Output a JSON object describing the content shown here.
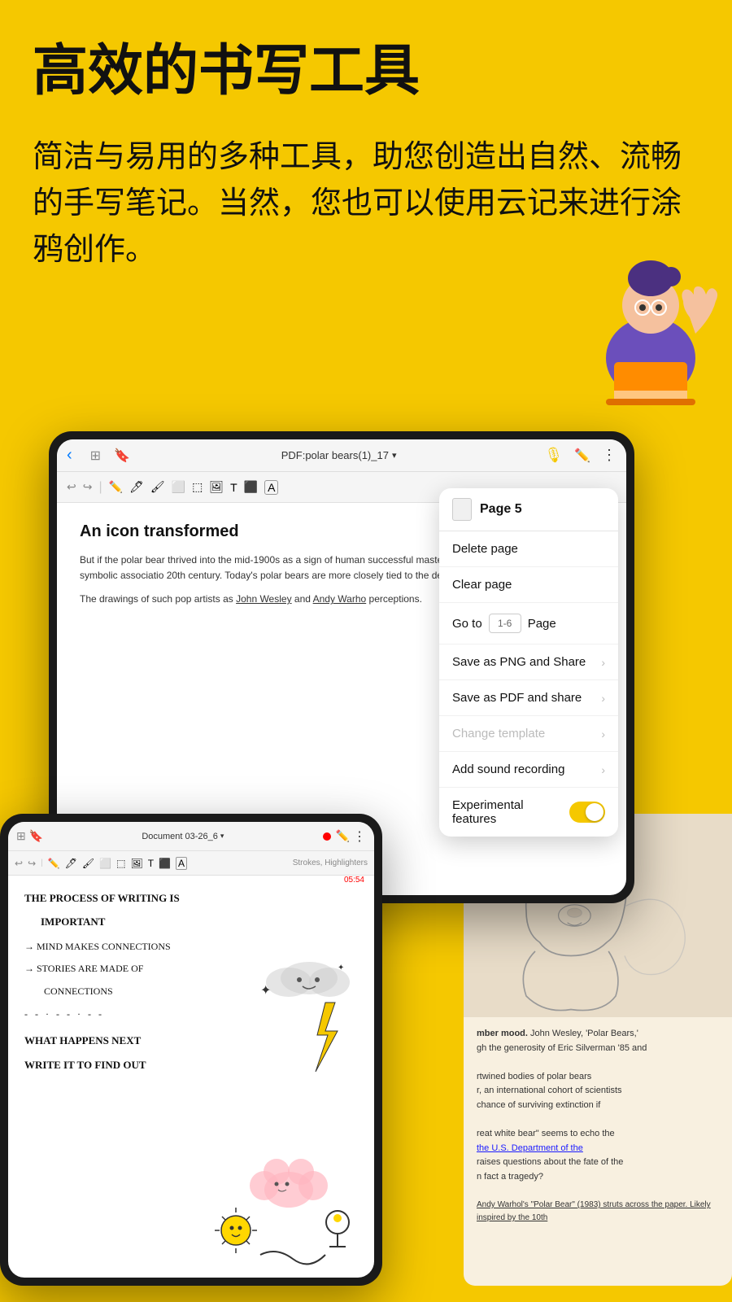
{
  "header": {
    "title": "高效的书写工具",
    "subtitle": "简洁与易用的多种工具，助您创造出自然、流畅的手写笔记。当然，您也可以使用云记来进行涂鸦创作。"
  },
  "tablet_main": {
    "title": "PDF:polar bears(1)_17",
    "toolbar_back": "‹",
    "article_title": "An icon transformed",
    "article_body_1": "But if the polar bear thrived into the mid-1900s as a sign of human successful mastery of antagonistic forces, this symbolic association 20th century. Today's polar bears are more closely tied to the dem belief in conquest and domination.",
    "article_body_2": "The drawings of such pop artists as John Wesley and Andy Warho perceptions."
  },
  "popup": {
    "page_label": "Page 5",
    "delete_page": "Delete page",
    "clear_page": "Clear page",
    "goto_label": "Go to",
    "goto_placeholder": "1-6",
    "goto_page": "Page",
    "save_png": "Save as PNG and Share",
    "save_pdf": "Save as PDF and share",
    "change_template": "Change template",
    "add_sound": "Add sound recording",
    "experimental": "Experimental features"
  },
  "tablet_secondary": {
    "title": "Document 03-26_6",
    "strokes_label": "Strokes, Highlighters",
    "timer": "05:54",
    "lines": [
      "THE PROCESS OF WRITING IS",
      "IMPORTANT",
      "→ MIND MAKES CONNECTIONS",
      "→ STORIES ARE MADE OF",
      "   CONNECTIONS",
      "- - · - - · - -",
      "WHAT HAPPENS NEXT",
      "WRITE IT TO FIND OUT"
    ]
  },
  "pdf_continuation": {
    "line1": "mber mood. John Wesley, 'Polar Bears,'",
    "line2": "gh the generosity of Eric Silverman '85 and",
    "line3": "",
    "line4": "rtwined bodies of polar bears",
    "line5": "r, an international cohort of scientists",
    "line6": "chance of surviving extinction if",
    "line7": "",
    "line8": "reat white bear\" seems to echo the",
    "line9": "the U.S. Department of the",
    "line10": "raises questions about the fate of the",
    "line11": "n fact a tragedy?",
    "line12": "",
    "line13": "Andy Warhol's \"Polar Bear\" (1983) struts across the paper. Likely inspired by the 10th"
  },
  "colors": {
    "background": "#F5C800",
    "tablet_frame": "#1a1a1a",
    "popup_bg": "#ffffff",
    "toggle_on": "#F5C800",
    "accent": "#007AFF"
  }
}
